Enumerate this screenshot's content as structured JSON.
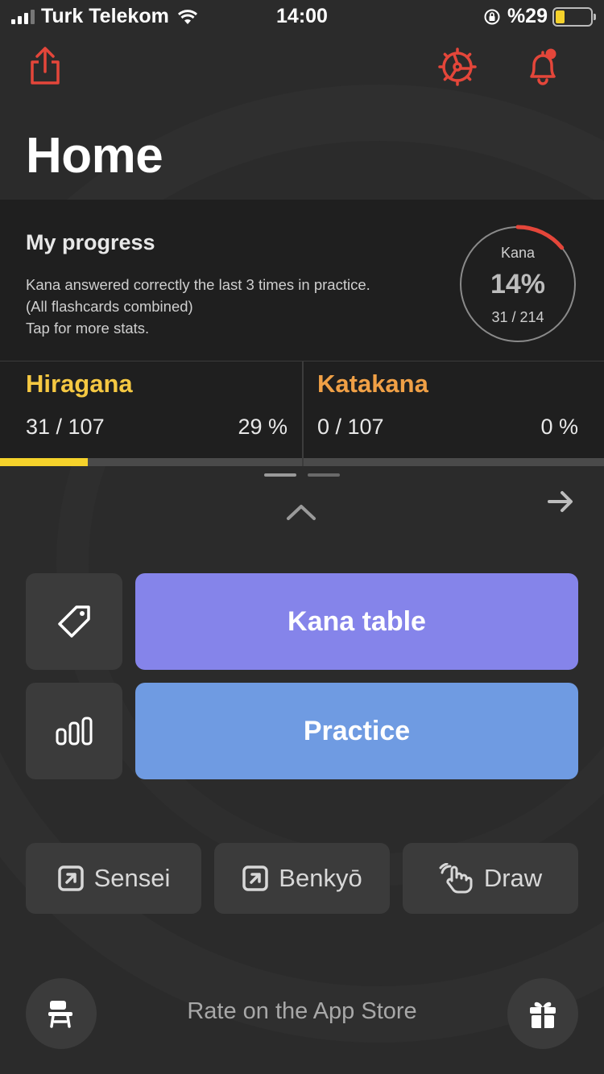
{
  "status_bar": {
    "carrier": "Turk Telekom",
    "time": "14:00",
    "battery_text": "%29",
    "battery_level": 0.29
  },
  "toolbar": {
    "share_icon": "share-icon",
    "settings_icon": "gear-icon",
    "notifications_icon": "bell-icon"
  },
  "page": {
    "title": "Home"
  },
  "progress": {
    "title": "My progress",
    "description_lines": [
      "Kana answered correctly the last 3 times in practice.",
      "(All flashcards combined)",
      "Tap for more stats."
    ],
    "ring": {
      "label": "Kana",
      "percent_text": "14%",
      "count_text": "31 / 214",
      "fraction": 0.14
    }
  },
  "kana": [
    {
      "name": "Hiragana",
      "count": "31 / 107",
      "percent": "29 %",
      "fraction": 0.29,
      "color": "#f5c842"
    },
    {
      "name": "Katakana",
      "count": "0 / 107",
      "percent": "0 %",
      "fraction": 0,
      "color": "#f0a046"
    }
  ],
  "actions": {
    "kana_table": "Kana table",
    "practice": "Practice",
    "tag_icon": "tag-icon",
    "stats_icon": "stats-icon"
  },
  "external": {
    "sensei": "Sensei",
    "benkyo": "Benkyō",
    "draw": "Draw"
  },
  "footer": {
    "rate": "Rate on the App Store",
    "left_icon": "desk-icon",
    "right_icon": "gift-icon"
  },
  "colors": {
    "accent_red": "#e4463a",
    "kana_table_bg": "#8584ea",
    "practice_bg": "#6f9be2"
  }
}
